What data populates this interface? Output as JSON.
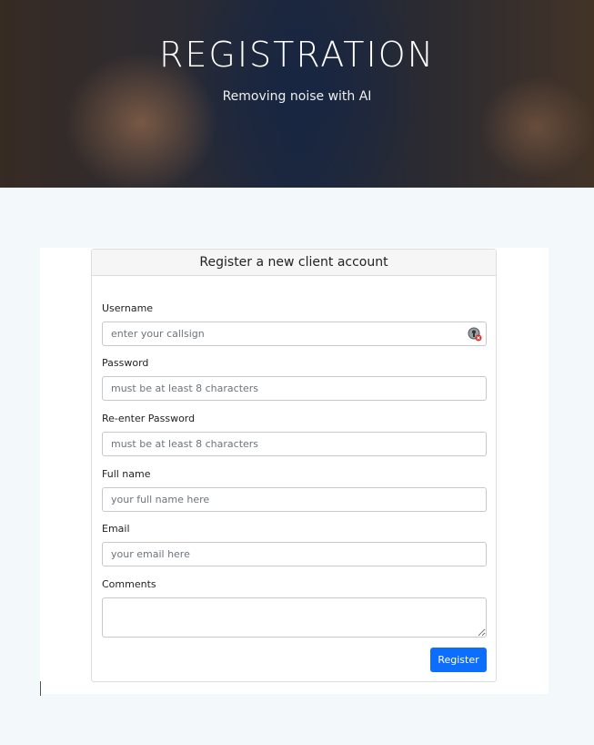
{
  "hero": {
    "title": "REGISTRATION",
    "subtitle": "Removing noise with AI"
  },
  "form": {
    "header": "Register a new client account",
    "fields": [
      {
        "label": "Username",
        "placeholder": "enter your callsign",
        "value": ""
      },
      {
        "label": "Password",
        "placeholder": "must be at least 8 characters",
        "value": ""
      },
      {
        "label": "Re-enter Password",
        "placeholder": "must be at least 8 characters",
        "value": ""
      },
      {
        "label": "Full name",
        "placeholder": "your full name here",
        "value": ""
      },
      {
        "label": "Email",
        "placeholder": "your email here",
        "value": ""
      }
    ],
    "comments_label": "Comments",
    "comments_value": "",
    "submit_label": "Register",
    "password_manager_icon": "password-manager-icon"
  }
}
